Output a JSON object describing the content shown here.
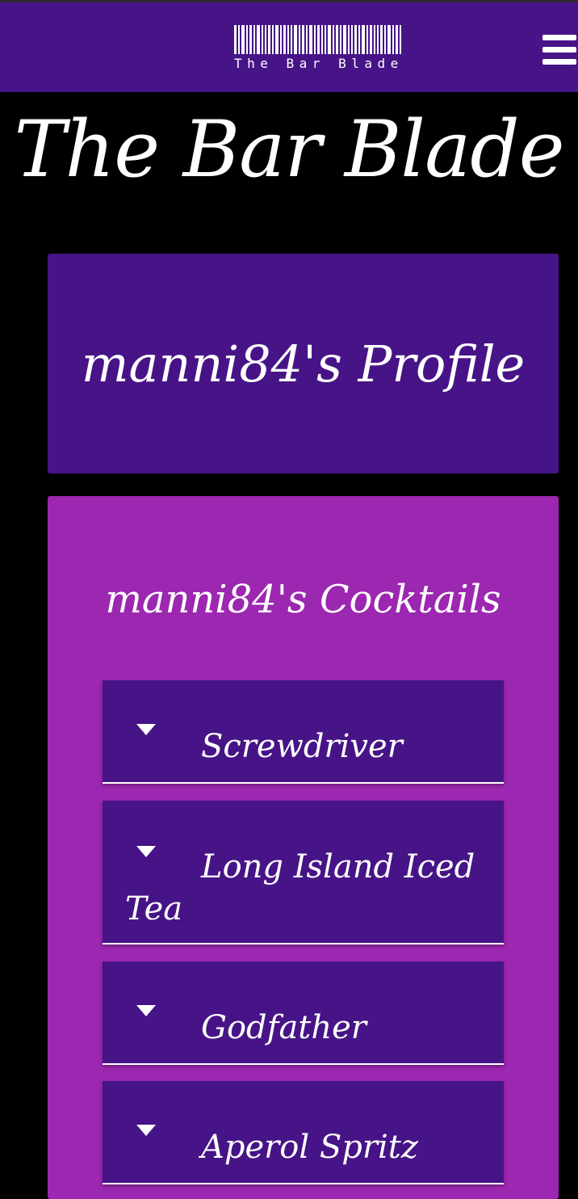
{
  "header": {
    "logo_text": "The Bar Blade",
    "menu_icon": "hamburger-menu-icon"
  },
  "site_title": "The Bar Blade",
  "profile": {
    "title": "manni84's Profile"
  },
  "cocktails": {
    "title": "manni84's Cocktails",
    "items": [
      {
        "label": "Screwdriver",
        "icon": "caret-down-icon"
      },
      {
        "label": "Long Island Iced Tea",
        "icon": "caret-down-icon"
      },
      {
        "label": "Godfather",
        "icon": "caret-down-icon"
      },
      {
        "label": "Aperol Spritz",
        "icon": "caret-down-icon"
      }
    ]
  },
  "colors": {
    "header_bg": "#471487",
    "page_bg": "#000000",
    "cocktails_bg": "#9c27b0",
    "item_bg": "#471487",
    "text": "#ffffff"
  }
}
